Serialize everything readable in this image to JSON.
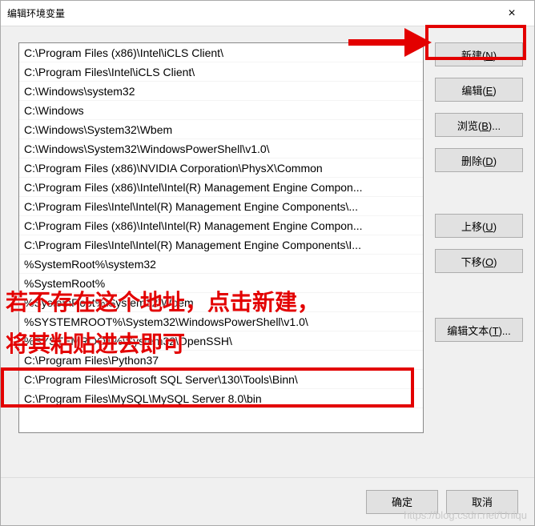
{
  "window": {
    "title": "编辑环境变量",
    "close": "×"
  },
  "list": {
    "items": [
      "C:\\Program Files (x86)\\Intel\\iCLS Client\\",
      "C:\\Program Files\\Intel\\iCLS Client\\",
      "C:\\Windows\\system32",
      "C:\\Windows",
      "C:\\Windows\\System32\\Wbem",
      "C:\\Windows\\System32\\WindowsPowerShell\\v1.0\\",
      "C:\\Program Files (x86)\\NVIDIA Corporation\\PhysX\\Common",
      "C:\\Program Files (x86)\\Intel\\Intel(R) Management Engine Compon...",
      "C:\\Program Files\\Intel\\Intel(R) Management Engine Components\\...",
      "C:\\Program Files (x86)\\Intel\\Intel(R) Management Engine Compon...",
      "C:\\Program Files\\Intel\\Intel(R) Management Engine Components\\I...",
      "%SystemRoot%\\system32",
      "%SystemRoot%",
      "%SystemRoot%\\System32\\Wbem",
      "%SYSTEMROOT%\\System32\\WindowsPowerShell\\v1.0\\",
      "%SYSTEMROOT%\\System32\\OpenSSH\\",
      "C:\\Program Files\\Python37",
      "C:\\Program Files\\Microsoft SQL Server\\130\\Tools\\Binn\\",
      "C:\\Program Files\\MySQL\\MySQL Server 8.0\\bin"
    ]
  },
  "buttons": {
    "new": {
      "label": "新建(",
      "key": "N",
      "suffix": ")"
    },
    "edit": {
      "label": "编辑(",
      "key": "E",
      "suffix": ")"
    },
    "browse": {
      "label": "浏览(",
      "key": "B",
      "suffix": ")..."
    },
    "delete": {
      "label": "删除(",
      "key": "D",
      "suffix": ")"
    },
    "moveup": {
      "label": "上移(",
      "key": "U",
      "suffix": ")"
    },
    "movedown": {
      "label": "下移(",
      "key": "O",
      "suffix": ")"
    },
    "edittext": {
      "label": "编辑文本(",
      "key": "T",
      "suffix": ")..."
    }
  },
  "footer": {
    "ok": "确定",
    "cancel": "取消"
  },
  "annotations": {
    "line1": "若不存在这个地址，点击新建，",
    "line2": "将其粘贴进去即可"
  },
  "watermark": "https://blog.csdn.net/Uniqu"
}
